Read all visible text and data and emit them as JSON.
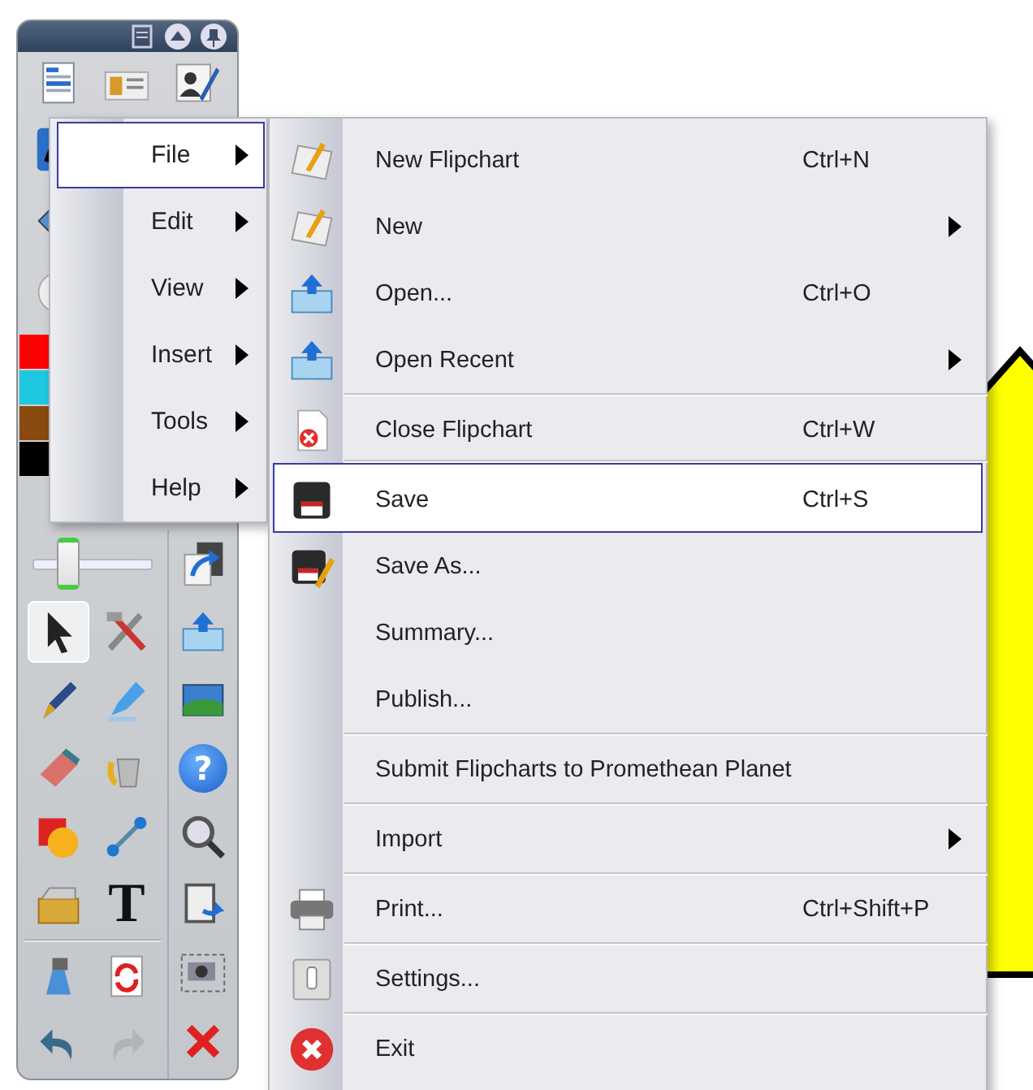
{
  "toolbar": {
    "top_tools": [
      {
        "kind": "browser"
      },
      {
        "kind": "resource"
      },
      {
        "kind": "profile"
      }
    ],
    "partial_tools": [
      {
        "kind": "pen-tile"
      },
      {
        "kind": "diamond"
      },
      {
        "kind": "circle"
      }
    ],
    "colors": [
      {
        "color": "#ff0000"
      },
      {
        "color": "#1ec8e0"
      },
      {
        "color": "#8a4a10"
      },
      {
        "color": "#000000"
      }
    ],
    "slider": {
      "level": 0.3
    },
    "tools": [
      {
        "kind": "pointer",
        "selected": true
      },
      {
        "kind": "tools",
        "selected": false
      },
      {
        "kind": "pen",
        "selected": false
      },
      {
        "kind": "highlighter",
        "selected": false
      },
      {
        "kind": "eraser",
        "selected": false
      },
      {
        "kind": "fill",
        "selected": false
      },
      {
        "kind": "shapes",
        "selected": false
      },
      {
        "kind": "connector",
        "selected": false
      },
      {
        "kind": "resbox",
        "selected": false
      },
      {
        "kind": "text",
        "selected": false,
        "glyph": "T"
      },
      {
        "kind": "cleaner",
        "selected": false
      },
      {
        "kind": "reset",
        "selected": false
      },
      {
        "kind": "undo",
        "selected": false
      },
      {
        "kind": "redo",
        "selected": false
      }
    ],
    "side_tools": [
      {
        "kind": "sendpage"
      },
      {
        "kind": "open"
      },
      {
        "kind": "picture"
      },
      {
        "kind": "help",
        "glyph": "?"
      },
      {
        "kind": "search"
      },
      {
        "kind": "paste"
      },
      {
        "kind": "camera"
      },
      {
        "kind": "closex"
      }
    ]
  },
  "main_menu": [
    {
      "label": "File",
      "submenu": true,
      "selected": true
    },
    {
      "label": "Edit",
      "submenu": true,
      "selected": false
    },
    {
      "label": "View",
      "submenu": true,
      "selected": false
    },
    {
      "label": "Insert",
      "submenu": true,
      "selected": false
    },
    {
      "label": "Tools",
      "submenu": true,
      "selected": false
    },
    {
      "label": "Help",
      "submenu": true,
      "selected": false
    }
  ],
  "file_menu": [
    {
      "kind": "flipchart",
      "label": "New Flipchart",
      "shortcut": "Ctrl+N",
      "submenu": false,
      "selected": false,
      "separator_before": false
    },
    {
      "kind": "flipchart",
      "label": "New",
      "submenu": true,
      "selected": false,
      "separator_before": false
    },
    {
      "kind": "open",
      "label": "Open...",
      "shortcut": "Ctrl+O",
      "submenu": false,
      "selected": false,
      "separator_before": false
    },
    {
      "kind": "open",
      "label": "Open Recent",
      "submenu": true,
      "selected": false,
      "separator_before": false
    },
    {
      "kind": "close",
      "label": "Close Flipchart",
      "shortcut": "Ctrl+W",
      "submenu": false,
      "selected": false,
      "separator_before": true
    },
    {
      "kind": "save",
      "label": "Save",
      "shortcut": "Ctrl+S",
      "submenu": false,
      "selected": true,
      "separator_before": true
    },
    {
      "kind": "saveas",
      "label": "Save As...",
      "submenu": false,
      "selected": false,
      "separator_before": false
    },
    {
      "kind": "plain",
      "label": "Summary...",
      "submenu": false,
      "selected": false,
      "separator_before": false
    },
    {
      "kind": "plain",
      "label": "Publish...",
      "submenu": false,
      "selected": false,
      "separator_before": false
    },
    {
      "kind": "plain",
      "label": "Submit Flipcharts to Promethean Planet",
      "submenu": false,
      "selected": false,
      "separator_before": true
    },
    {
      "kind": "plain",
      "label": "Import",
      "submenu": true,
      "selected": false,
      "separator_before": true
    },
    {
      "kind": "print",
      "label": "Print...",
      "shortcut": "Ctrl+Shift+P",
      "submenu": false,
      "selected": false,
      "separator_before": true
    },
    {
      "kind": "settings",
      "label": "Settings...",
      "submenu": false,
      "selected": false,
      "separator_before": true
    },
    {
      "kind": "exit",
      "label": "Exit",
      "submenu": false,
      "selected": false,
      "separator_before": true
    }
  ]
}
